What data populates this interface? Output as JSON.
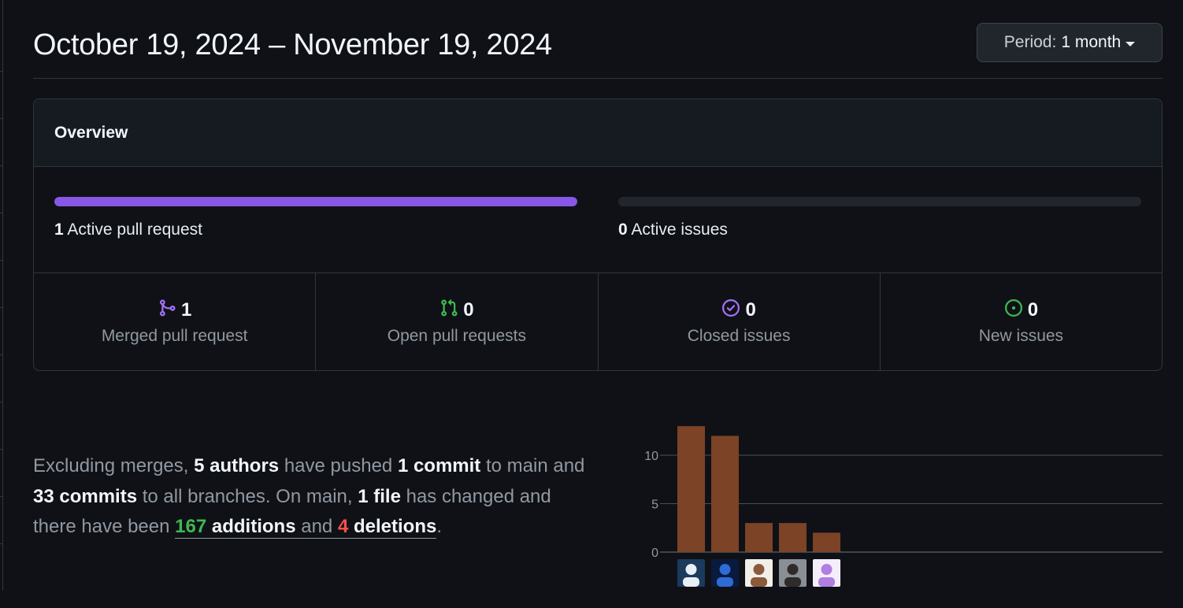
{
  "header": {
    "date_range": "October 19, 2024 – November 19, 2024",
    "period_label": "Period:",
    "period_value": "1 month"
  },
  "overview": {
    "title": "Overview",
    "pull_requests": {
      "count": "1",
      "label": "Active pull request",
      "fill_fraction": 1.0
    },
    "issues": {
      "count": "0",
      "label": "Active issues",
      "fill_fraction": 0.0
    },
    "stats": [
      {
        "icon": "merge-icon",
        "count": "1",
        "label": "Merged pull request",
        "color": "#a371f7"
      },
      {
        "icon": "pull-request-icon",
        "count": "0",
        "label": "Open pull requests",
        "color": "#3fb950"
      },
      {
        "icon": "issue-closed-icon",
        "count": "0",
        "label": "Closed issues",
        "color": "#a371f7"
      },
      {
        "icon": "issue-opened-icon",
        "count": "0",
        "label": "New issues",
        "color": "#3fb950"
      }
    ]
  },
  "summary": {
    "p1": "Excluding merges,",
    "authors": "5 authors",
    "p2": "have pushed",
    "commit_main": "1 commit",
    "p3": "to main and",
    "commits_all": "33 commits",
    "p4": "to all branches. On main,",
    "files": "1 file",
    "p5": "has changed and there have been",
    "additions_count": "167",
    "additions_word": "additions",
    "p6": "and",
    "deletions_count": "4",
    "deletions_word": "deletions",
    "p7": "."
  },
  "chart_data": {
    "type": "bar",
    "categories": [
      "author-1",
      "author-2",
      "author-3",
      "author-4",
      "author-5"
    ],
    "values": [
      13,
      12,
      3,
      3,
      2
    ],
    "yticks": [
      "0",
      "5",
      "10"
    ],
    "ylim": [
      0,
      13
    ],
    "bar_color": "#7c4326",
    "grid": true
  }
}
